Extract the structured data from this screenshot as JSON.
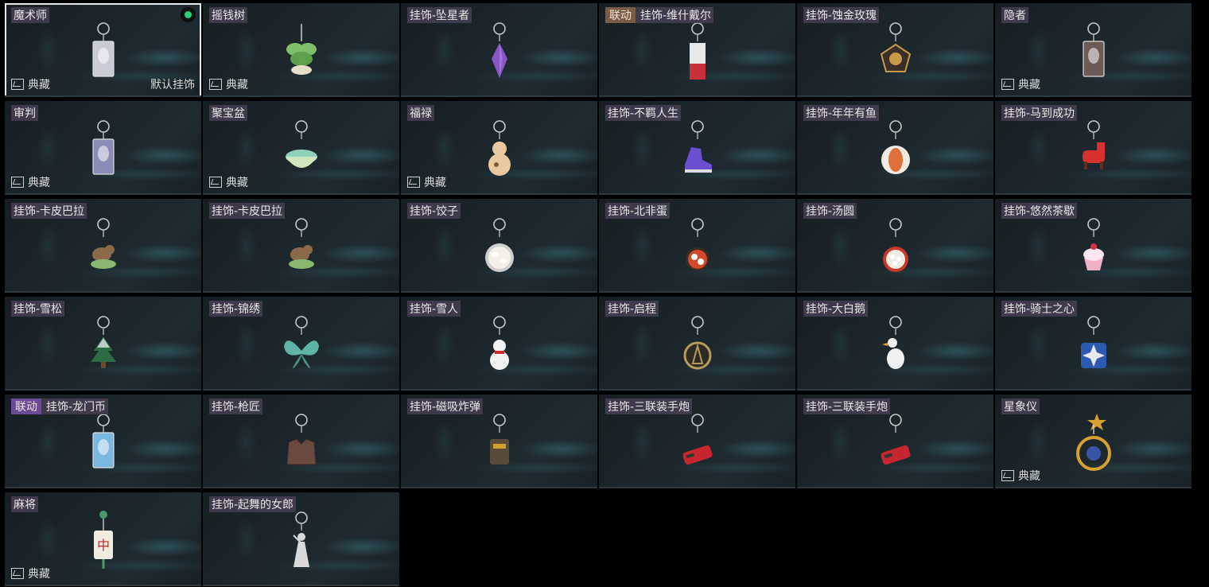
{
  "collect_label": "典藏",
  "default_label": "默认挂饰",
  "items": [
    {
      "name": "魔术师",
      "tag": "",
      "collect": true,
      "selected": true,
      "default": true,
      "equipped": true,
      "icon": "card-charm-icon",
      "color": "#c9ccd6"
    },
    {
      "name": "摇钱树",
      "tag": "",
      "collect": true,
      "icon": "money-tree-icon",
      "color": "#7fbf6a"
    },
    {
      "name": "挂饰-坠星者",
      "tag": "",
      "collect": false,
      "icon": "crystal-icon",
      "color": "#8a55c8"
    },
    {
      "name": "挂饰-维什戴尔",
      "tag": "联动",
      "collect": false,
      "icon": "tag-charm-icon",
      "color": "#c8313a"
    },
    {
      "name": "挂饰-蚀金玫瑰",
      "tag": "",
      "collect": false,
      "icon": "gold-rose-icon",
      "color": "#c89a4a"
    },
    {
      "name": "隐者",
      "tag": "",
      "collect": true,
      "icon": "card-charm-icon",
      "color": "#6b5a55"
    },
    {
      "name": "审判",
      "tag": "",
      "collect": true,
      "icon": "card-charm-icon",
      "color": "#8a8cb8"
    },
    {
      "name": "聚宝盆",
      "tag": "",
      "collect": true,
      "icon": "treasure-bowl-icon",
      "color": "#8fd0b8"
    },
    {
      "name": "福禄",
      "tag": "",
      "collect": true,
      "icon": "gourd-icon",
      "color": "#e8c9a0"
    },
    {
      "name": "挂饰-不羁人生",
      "tag": "",
      "collect": false,
      "icon": "sneaker-icon",
      "color": "#6a4fd0"
    },
    {
      "name": "挂饰-年年有鱼",
      "tag": "",
      "collect": false,
      "icon": "fish-plate-icon",
      "color": "#e0703a"
    },
    {
      "name": "挂饰-马到成功",
      "tag": "",
      "collect": false,
      "icon": "horse-icon",
      "color": "#d8302e"
    },
    {
      "name": "挂饰-卡皮巴拉",
      "tag": "",
      "collect": false,
      "icon": "capybara-icon",
      "color": "#8a6a48"
    },
    {
      "name": "挂饰-卡皮巴拉",
      "tag": "",
      "collect": false,
      "icon": "capybara-icon",
      "color": "#8a6a48"
    },
    {
      "name": "挂饰-饺子",
      "tag": "",
      "collect": false,
      "icon": "dumpling-plate-icon",
      "color": "#e8e4d8"
    },
    {
      "name": "挂饰-北非蛋",
      "tag": "",
      "collect": false,
      "icon": "shakshuka-pan-icon",
      "color": "#d24a2a"
    },
    {
      "name": "挂饰-汤圆",
      "tag": "",
      "collect": false,
      "icon": "tangyuan-bowl-icon",
      "color": "#c9362a"
    },
    {
      "name": "挂饰-悠然茶歇",
      "tag": "",
      "collect": false,
      "icon": "cupcake-icon",
      "color": "#f0b0c8"
    },
    {
      "name": "挂饰-雪松",
      "tag": "",
      "collect": false,
      "icon": "pine-tree-icon",
      "color": "#e8f0ee"
    },
    {
      "name": "挂饰-锦绣",
      "tag": "",
      "collect": false,
      "icon": "butterfly-icon",
      "color": "#5fb4a8"
    },
    {
      "name": "挂饰-雪人",
      "tag": "",
      "collect": false,
      "icon": "snowman-icon",
      "color": "#f2f2f2"
    },
    {
      "name": "挂饰-启程",
      "tag": "",
      "collect": false,
      "icon": "compass-ring-icon",
      "color": "#b89a5a"
    },
    {
      "name": "挂饰-大白鹅",
      "tag": "",
      "collect": false,
      "icon": "goose-icon",
      "color": "#f0f0f0"
    },
    {
      "name": "挂饰-骑士之心",
      "tag": "",
      "collect": false,
      "icon": "knight-shield-icon",
      "color": "#2c5ab0"
    },
    {
      "name": "挂饰-龙门币",
      "tag": "联动",
      "tag_purple": true,
      "collect": false,
      "icon": "card-charm-icon",
      "color": "#7ab8e0"
    },
    {
      "name": "挂饰-枪匠",
      "tag": "",
      "collect": false,
      "icon": "vest-icon",
      "color": "#6a4a40"
    },
    {
      "name": "挂饰-磁吸炸弹",
      "tag": "",
      "collect": false,
      "icon": "bomb-icon",
      "color": "#5a4a3a"
    },
    {
      "name": "挂饰-三联装手炮",
      "tag": "",
      "collect": false,
      "icon": "hand-cannon-icon",
      "color": "#c8262e"
    },
    {
      "name": "挂饰-三联装手炮",
      "tag": "",
      "collect": false,
      "icon": "hand-cannon-icon",
      "color": "#c8262e"
    },
    {
      "name": "星象仪",
      "tag": "",
      "collect": true,
      "icon": "astrolabe-icon",
      "color": "#d8a030"
    },
    {
      "name": "麻将",
      "tag": "",
      "collect": true,
      "icon": "mahjong-tile-icon",
      "color": "#f0ece0"
    },
    {
      "name": "挂饰-起舞的女郎",
      "tag": "",
      "collect": false,
      "icon": "dancer-figure-icon",
      "color": "#d8d8d8"
    }
  ]
}
